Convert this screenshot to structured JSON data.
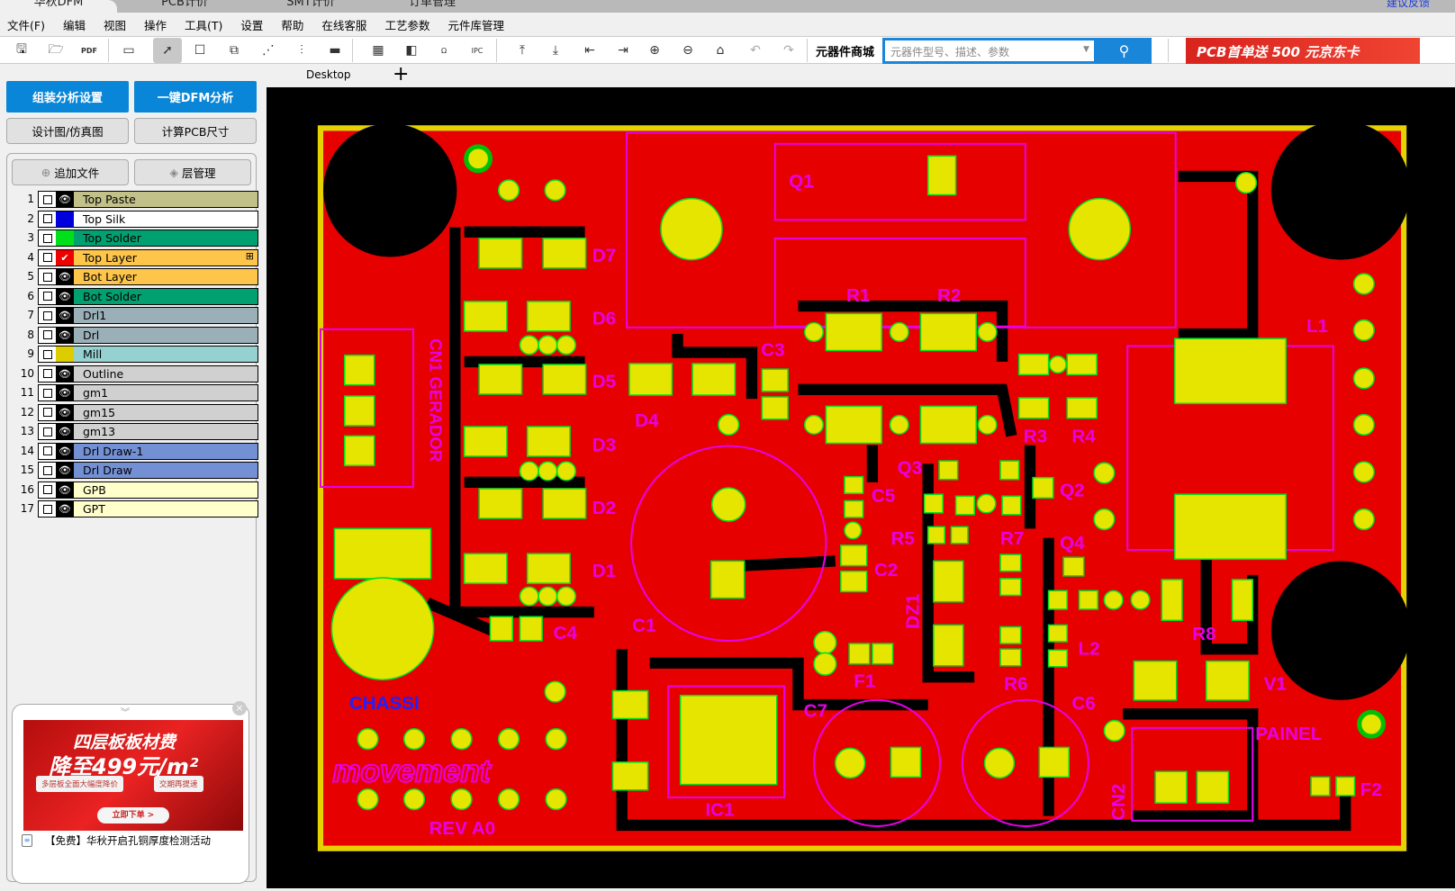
{
  "title_tabs": [
    {
      "label": "华秋DFM",
      "active": true
    },
    {
      "label": "PCB计价"
    },
    {
      "label": "SMT计价"
    },
    {
      "label": "订单管理"
    }
  ],
  "feedback_link": "建议反馈",
  "menu": [
    "文件(F)",
    "编辑",
    "视图",
    "操作",
    "工具(T)",
    "设置",
    "帮助",
    "在线客服",
    "工艺参数",
    "元件库管理"
  ],
  "toolbar": {
    "icons": [
      "save-icon",
      "open-folder-icon",
      "pdf-icon",
      "layout-icon",
      "select-cursor-icon",
      "board-select-icon",
      "move-icon",
      "route-icon",
      "connect-icon",
      "ruler-icon",
      "panel-icon",
      "component-icon",
      "ohm-icon",
      "ipc-icon",
      "align-top-icon",
      "align-bottom-icon",
      "align-left-icon",
      "align-right-icon",
      "zoom-in-icon",
      "zoom-out-icon",
      "home-icon",
      "undo-icon",
      "redo-icon"
    ],
    "shop_label": "元器件商城",
    "shop_placeholder": "元器件型号、描述、参数",
    "ad_text": "PCB首单送 500 元京东卡"
  },
  "doc_tab": "Desktop",
  "left": {
    "buttons": {
      "assembly": "组装分析设置",
      "dfm": "一键DFM分析",
      "design": "设计图/仿真图",
      "size": "计算PCB尺寸",
      "add_file": "追加文件",
      "layer_mgr": "层管理"
    },
    "layers": [
      {
        "n": "1",
        "name": "Top Paste",
        "bg": "#c2c18a",
        "swatch": "eye"
      },
      {
        "n": "2",
        "name": "Top Silk",
        "bg": "#ffffff",
        "swatch": "#0000dd"
      },
      {
        "n": "3",
        "name": "Top Solder",
        "bg": "#00a070",
        "swatch": "#00e01a"
      },
      {
        "n": "4",
        "name": "Top Layer",
        "bg": "#fec54b",
        "swatch": "check"
      },
      {
        "n": "5",
        "name": "Bot Layer",
        "bg": "#fec54b",
        "swatch": "eye"
      },
      {
        "n": "6",
        "name": "Bot Solder",
        "bg": "#00a070",
        "swatch": "eye"
      },
      {
        "n": "7",
        "name": "Drl1",
        "bg": "#9aafb7",
        "swatch": "eye"
      },
      {
        "n": "8",
        "name": "Drl",
        "bg": "#9aafb7",
        "swatch": "eye"
      },
      {
        "n": "9",
        "name": "Mill",
        "bg": "#96d1d1",
        "swatch": "#dccc00"
      },
      {
        "n": "10",
        "name": "Outline",
        "bg": "#d0d0d0",
        "swatch": "eye"
      },
      {
        "n": "11",
        "name": "gm1",
        "bg": "#d0d0d0",
        "swatch": "eye"
      },
      {
        "n": "12",
        "name": "gm15",
        "bg": "#d0d0d0",
        "swatch": "eye"
      },
      {
        "n": "13",
        "name": "gm13",
        "bg": "#d0d0d0",
        "swatch": "eye"
      },
      {
        "n": "14",
        "name": "Drl Draw-1",
        "bg": "#7490d4",
        "swatch": "eye"
      },
      {
        "n": "15",
        "name": "Drl Draw",
        "bg": "#7490d4",
        "swatch": "eye"
      },
      {
        "n": "16",
        "name": "GPB",
        "bg": "#ffffcc",
        "swatch": "eye"
      },
      {
        "n": "17",
        "name": "GPT",
        "bg": "#ffffcc",
        "swatch": "eye"
      }
    ],
    "ad": {
      "line1": "四层板板材费",
      "line2": "降至499元/m²",
      "pill1": "多层板全面大幅度降价",
      "pill2": "交期再提速",
      "cta": "立即下单 >",
      "caption": "【免费】华秋开启孔铜厚度检测活动"
    }
  },
  "pcb": {
    "colors": {
      "copper": "#e60000",
      "pad": "#e5e500",
      "silk": "#e600e6",
      "top_silk": "#0000ff",
      "outline": "#e5d200"
    },
    "labels": {
      "Q1": "Q1",
      "D7": "D7",
      "D6": "D6",
      "D5": "D5",
      "D4": "D4",
      "D3": "D3",
      "D2": "D2",
      "D1": "D1",
      "CN1": "CN1 GERADOR",
      "C3": "C3",
      "R1": "R1",
      "R2": "R2",
      "R3": "R3",
      "R4": "R4",
      "L1": "L1",
      "C5": "C5",
      "Q3": "Q3",
      "Q2": "Q2",
      "R5": "R5",
      "R7": "R7",
      "Q4": "Q4",
      "C2": "C2",
      "DZ1": "DZ1",
      "C1": "C1",
      "C4": "C4",
      "F1": "F1",
      "R6": "R6",
      "L2": "L2",
      "R8": "R8",
      "V1": "V1",
      "C7": "C7",
      "C6": "C6",
      "CHASSI": "CHASSI",
      "PAINEL": "PAINEL",
      "IC1": "IC1",
      "REV": "REV A0",
      "CN2": "CN2",
      "F2": "F2",
      "logo": "movement"
    }
  }
}
